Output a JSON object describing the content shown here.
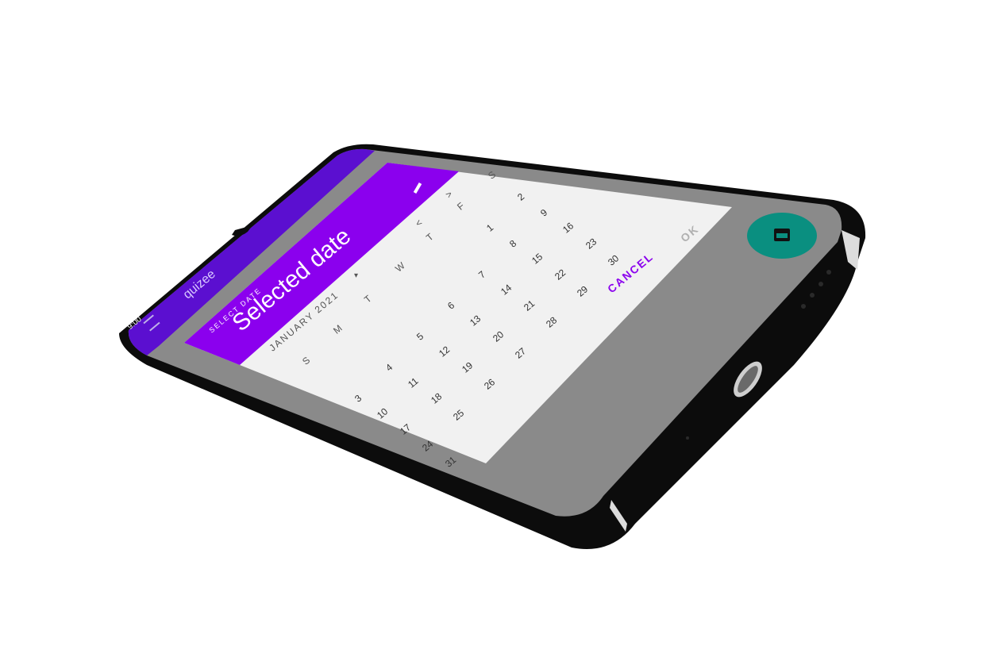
{
  "status_bar": {
    "time": "9:00"
  },
  "app_bar": {
    "title": "quizee",
    "menu_icon": "menu-icon"
  },
  "date_picker": {
    "label": "SELECT DATE",
    "selected_text": "Selected date",
    "month_year": "JANUARY 2021",
    "weekdays": [
      "S",
      "M",
      "T",
      "W",
      "T",
      "F",
      "S"
    ],
    "weeks": [
      [
        "",
        "",
        "",
        "",
        "",
        "1",
        "2"
      ],
      [
        "3",
        "4",
        "5",
        "6",
        "7",
        "8",
        "9"
      ],
      [
        "10",
        "11",
        "12",
        "13",
        "14",
        "15",
        "16"
      ],
      [
        "17",
        "18",
        "19",
        "20",
        "21",
        "22",
        "23"
      ],
      [
        "24",
        "25",
        "26",
        "27",
        "28",
        "29",
        "30"
      ],
      [
        "31",
        "",
        "",
        "",
        "",
        "",
        ""
      ]
    ],
    "cancel_label": "CANCEL",
    "ok_label": "OK",
    "prev_icon": "chevron-left-icon",
    "next_icon": "chevron-right-icon",
    "dropdown_icon": "caret-down-icon",
    "edit_icon": "pencil-icon"
  },
  "fab": {
    "icon": "calendar-icon"
  },
  "colors": {
    "header_purple": "#8b00ee",
    "app_bar_purple": "#6a00f4",
    "status_purple": "#4b00b0",
    "fab_teal": "#0a8f80",
    "scrim": "#8a8a8a",
    "dialog_bg": "#f1f1f1"
  }
}
